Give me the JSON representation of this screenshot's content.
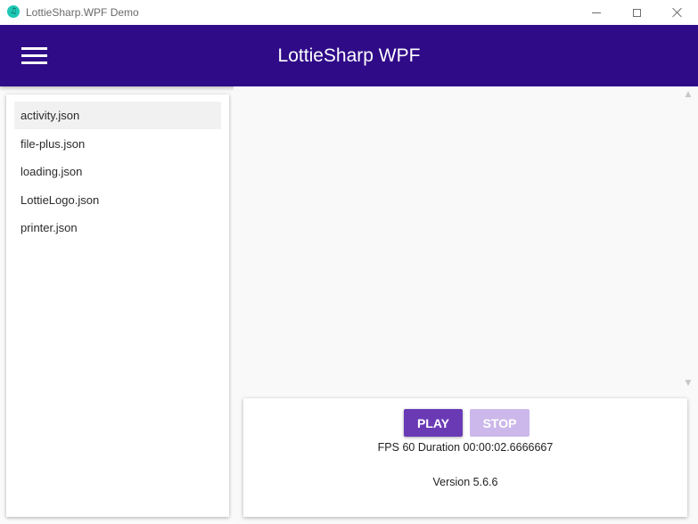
{
  "window": {
    "title": "LottieSharp.WPF Demo",
    "icon_glyph": "♫"
  },
  "header": {
    "title": "LottieSharp WPF",
    "color": "#2f0b88"
  },
  "sidebar": {
    "items": [
      {
        "label": "activity.json",
        "selected": true
      },
      {
        "label": "file-plus.json",
        "selected": false
      },
      {
        "label": "loading.json",
        "selected": false
      },
      {
        "label": "LottieLogo.json",
        "selected": false
      },
      {
        "label": "printer.json",
        "selected": false
      }
    ]
  },
  "controls": {
    "play_label": "PLAY",
    "stop_label": "STOP",
    "stop_enabled": false,
    "fps_text": "FPS 60 Duration 00:00:02.6666667",
    "version_text": "Version 5.6.6",
    "accent": "#6a3ab5",
    "disabled_accent": "#ccb8ea"
  },
  "scroll": {
    "up_glyph": "▲",
    "down_glyph": "▼"
  }
}
